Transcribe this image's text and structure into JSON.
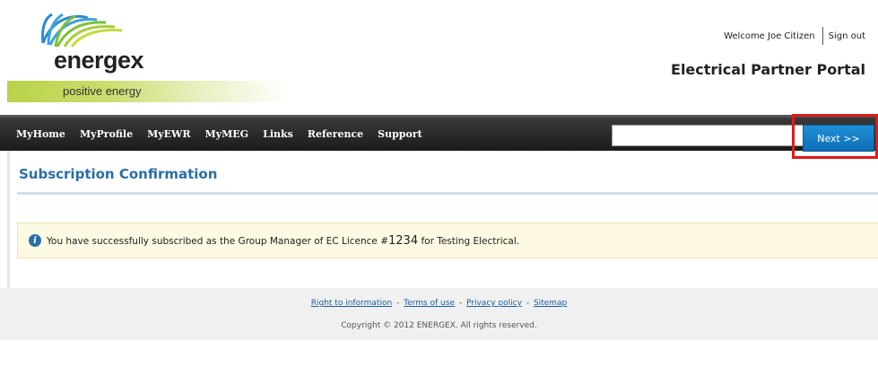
{
  "header": {
    "logo_word": "energex",
    "logo_tagline": "positive energy",
    "welcome": "Welcome Joe Citizen",
    "signout": "Sign out",
    "portal_title": "Electrical Partner Portal"
  },
  "nav": {
    "items": [
      "MyHome",
      "MyProfile",
      "MyEWR",
      "MyMEG",
      "Links",
      "Reference",
      "Support"
    ],
    "search_value": ""
  },
  "main": {
    "title": "Subscription Confirmation",
    "message_before": "You have successfully subscribed as the Group Manager of EC Licence #",
    "licence_number": "1234",
    "message_after": " for Testing Electrical.",
    "next_label": "Next >>"
  },
  "footer": {
    "links": [
      "Right to information",
      "Terms of use",
      "Privacy policy",
      "Sitemap"
    ],
    "copyright": "Copyright © 2012 ENERGEX. All rights reserved."
  },
  "colors": {
    "accent_blue": "#2a6ea6",
    "button_blue": "#1f8fd6",
    "highlight_red": "#e01919",
    "logo_green": "#b9d34a"
  }
}
